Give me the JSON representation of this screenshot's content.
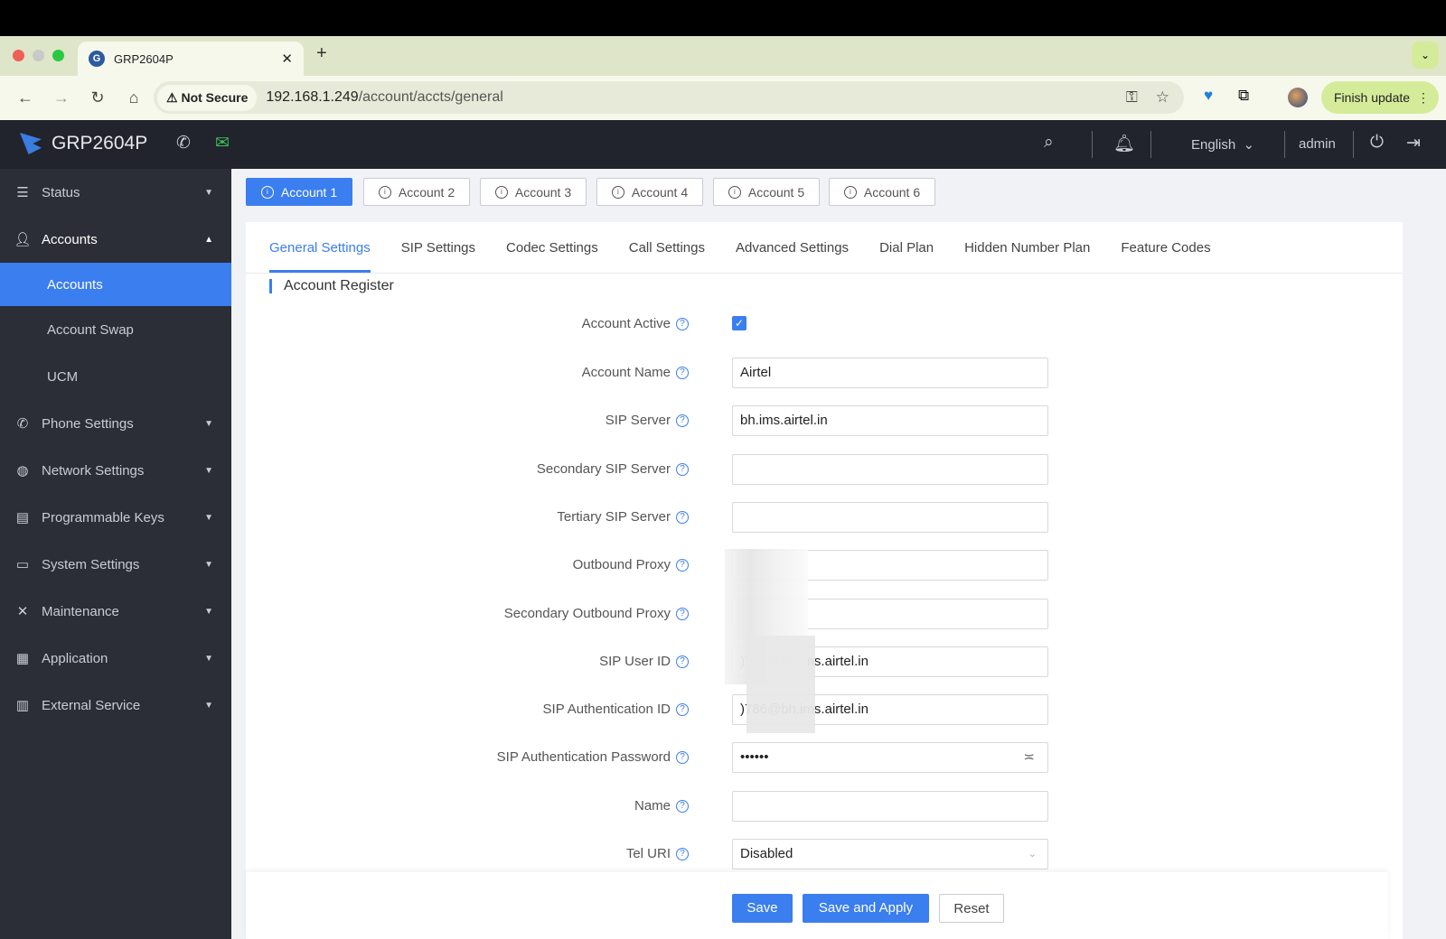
{
  "browser": {
    "tab_title": "GRP2604P",
    "not_secure": "Not Secure",
    "url_host": "192.168.1.249",
    "url_path": "/account/accts/general",
    "finish_update": "Finish update"
  },
  "header": {
    "title": "GRP2604P",
    "language": "English",
    "user": "admin"
  },
  "sidebar": {
    "items": [
      {
        "label": "Status",
        "icon": "list-icon"
      },
      {
        "label": "Accounts",
        "icon": "user-icon",
        "expanded": true,
        "children": [
          "Accounts",
          "Account Swap",
          "UCM"
        ]
      },
      {
        "label": "Phone Settings",
        "icon": "phone-icon"
      },
      {
        "label": "Network Settings",
        "icon": "globe-icon"
      },
      {
        "label": "Programmable Keys",
        "icon": "keys-icon"
      },
      {
        "label": "System Settings",
        "icon": "monitor-gear-icon"
      },
      {
        "label": "Maintenance",
        "icon": "tools-icon"
      },
      {
        "label": "Application",
        "icon": "grid-icon"
      },
      {
        "label": "External Service",
        "icon": "document-icon"
      }
    ]
  },
  "accounts": [
    "Account 1",
    "Account 2",
    "Account 3",
    "Account 4",
    "Account 5",
    "Account 6"
  ],
  "subtabs": [
    "General Settings",
    "SIP Settings",
    "Codec Settings",
    "Call Settings",
    "Advanced Settings",
    "Dial Plan",
    "Hidden Number Plan",
    "Feature Codes"
  ],
  "section": "Account Register",
  "form": {
    "account_active": {
      "label": "Account Active",
      "checked": true
    },
    "fields": [
      {
        "label": "Account Name",
        "value": "Airtel"
      },
      {
        "label": "SIP Server",
        "value": "bh.ims.airtel.in"
      },
      {
        "label": "Secondary SIP Server",
        "value": ""
      },
      {
        "label": "Tertiary SIP Server",
        "value": ""
      },
      {
        "label": "Outbound Proxy",
        "value": ""
      },
      {
        "label": "Secondary Outbound Proxy",
        "value": ""
      },
      {
        "label": "SIP User ID",
        "value": ")786@bh.ims.airtel.in"
      },
      {
        "label": "SIP Authentication ID",
        "value": ")786@bh.ims.airtel.in"
      },
      {
        "label": "SIP Authentication Password",
        "value": "••••••"
      },
      {
        "label": "Name",
        "value": ""
      },
      {
        "label": "Tel URI",
        "value": "Disabled"
      }
    ]
  },
  "buttons": {
    "save": "Save",
    "save_apply": "Save and Apply",
    "reset": "Reset"
  }
}
